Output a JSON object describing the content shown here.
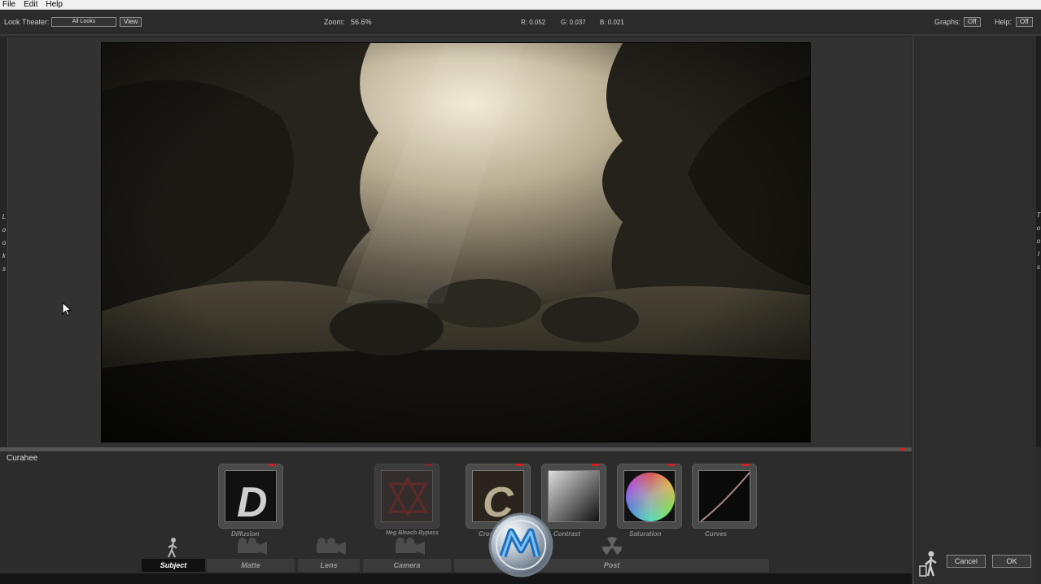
{
  "menu": [
    "File",
    "Edit",
    "Help"
  ],
  "toolbar": {
    "look_theater_label": "Look Theater:",
    "look_theater_value": "All Looks",
    "view_button": "View",
    "zoom_label": "Zoom:",
    "zoom_value": "56.6%",
    "r_readout": "R: 0.052",
    "g_readout": "G: 0.037",
    "b_readout": "B: 0.021",
    "graphs_label": "Graphs:",
    "graphs_value": "Off",
    "help_label": "Help:",
    "help_value": "Off"
  },
  "side_labels": {
    "left": [
      "L",
      "o",
      "o",
      "k",
      "s"
    ],
    "right": [
      "T",
      "o",
      "o",
      "l",
      "s"
    ]
  },
  "look_name": "Curahee",
  "tools": [
    {
      "label": "Diffusion",
      "glyph": "D"
    },
    {
      "label": "Neg Bleach Bypass"
    },
    {
      "label": "Cross Process",
      "glyph": "C"
    },
    {
      "label": "Contrast"
    },
    {
      "label": "Saturation"
    },
    {
      "label": "Curves"
    }
  ],
  "tabs": [
    "Subject",
    "Matte",
    "Lens",
    "Camera",
    "Post"
  ],
  "active_tab": "Subject",
  "buttons": {
    "cancel": "Cancel",
    "ok": "OK"
  },
  "icons": {
    "person": "person-icon",
    "camera": "camera-icon",
    "radiation": "radiation-icon",
    "trash": "trash-icon"
  },
  "colors": {
    "accent_red": "#cc2222",
    "panel": "#2c2c2c",
    "active_tab": "#111111"
  }
}
